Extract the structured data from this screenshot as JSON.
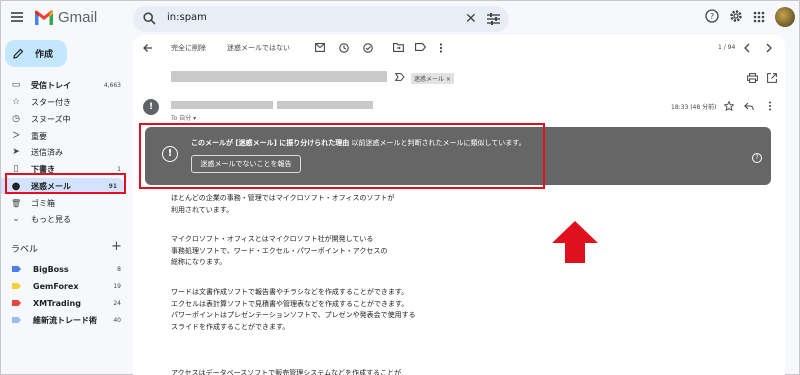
{
  "app": {
    "name": "Gmail"
  },
  "search": {
    "query": "in:spam"
  },
  "compose": {
    "label": "作成"
  },
  "nav": [
    {
      "icon": "inbox-icon",
      "label": "受信トレイ",
      "count": "4,663",
      "bold": true
    },
    {
      "icon": "star-icon",
      "label": "スター付き",
      "count": "",
      "bold": false
    },
    {
      "icon": "snooze-icon",
      "label": "スヌーズ中",
      "count": "",
      "bold": false
    },
    {
      "icon": "important-icon",
      "label": "重要",
      "count": "",
      "bold": false
    },
    {
      "icon": "sent-icon",
      "label": "送信済み",
      "count": "",
      "bold": false
    },
    {
      "icon": "draft-icon",
      "label": "下書き",
      "count": "1",
      "bold": true
    },
    {
      "icon": "spam-icon",
      "label": "迷惑メール",
      "count": "91",
      "bold": true,
      "active": true
    },
    {
      "icon": "trash-icon",
      "label": "ゴミ箱",
      "count": "",
      "bold": false
    },
    {
      "icon": "chevron-down-icon",
      "label": "もっと見る",
      "count": "",
      "bold": false
    }
  ],
  "labels_heading": "ラベル",
  "labels": [
    {
      "name": "BigBoss",
      "count": "8",
      "color": "#4c7df0"
    },
    {
      "name": "GemForex",
      "count": "19",
      "color": "#f6d03c"
    },
    {
      "name": "XMTrading",
      "count": "24",
      "color": "#e8453c"
    },
    {
      "name": "維新流トレード術",
      "count": "40",
      "color": "#9bbcf2"
    }
  ],
  "toolbar": {
    "delete_forever": "完全に削除",
    "not_spam": "迷惑メールではない",
    "pager": "1 / 94"
  },
  "message": {
    "subject_tag": "迷惑メール ×",
    "to": "To 自分 ▾",
    "time": "18:33 (48 分前)"
  },
  "banner": {
    "bold_text": "このメールが [迷惑メール] に振り分けられた理由",
    "text": " 以前迷惑メールと判断されたメールに類似しています。",
    "report_button": "迷惑メールでないことを報告"
  },
  "body_paragraphs": [
    [
      "ほとんどの企業の事務・管理ではマイクロソフト・オフィスのソフトが",
      "利用されています。"
    ],
    [
      "マイクロソフト・オフィスとはマイクロソフト社が開発している",
      "事務処理ソフトで、ワード・エクセル・パワーポイント・アクセスの",
      "総称になります。"
    ],
    [
      "ワードは文書作成ソフトで報告書やチラシなどを作成することができます。",
      "エクセルは表計算ソフトで見積書や管理表などを作成することができます。",
      "パワーポイントはプレゼンテーションソフトで、プレゼンや発表会で使用する",
      "スライドを作成することができます。"
    ],
    [
      "アクセスはデータベースソフトで販売管理システムなどを作成することが",
      "できます。"
    ]
  ],
  "colors": {
    "annotation_red": "#e0101e",
    "banner_bg": "#666666",
    "compose_bg": "#c2e7ff",
    "active_nav_bg": "#d3e3fd"
  }
}
